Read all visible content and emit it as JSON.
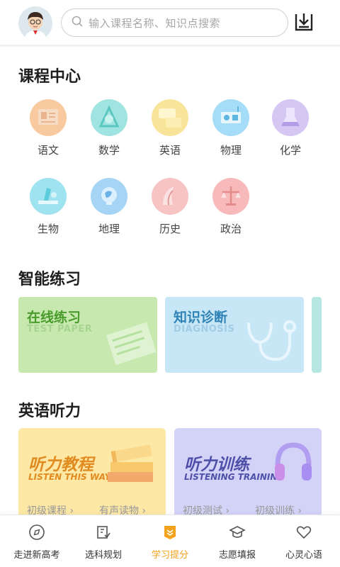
{
  "header": {
    "search_placeholder": "输入课程名称、知识点搜索"
  },
  "course_center": {
    "title": "课程中心",
    "subjects": [
      {
        "label": "语文",
        "icon": "chinese-icon",
        "color": "#f9c9a0"
      },
      {
        "label": "数学",
        "icon": "math-icon",
        "color": "#9fe4e0"
      },
      {
        "label": "英语",
        "icon": "english-icon",
        "color": "#f9e59a"
      },
      {
        "label": "物理",
        "icon": "physics-icon",
        "color": "#a5dcf7"
      },
      {
        "label": "化学",
        "icon": "chemistry-icon",
        "color": "#d5c7f3"
      },
      {
        "label": "生物",
        "icon": "biology-icon",
        "color": "#9ee3ef"
      },
      {
        "label": "地理",
        "icon": "geography-icon",
        "color": "#a5d4f4"
      },
      {
        "label": "历史",
        "icon": "history-icon",
        "color": "#f7c3c3"
      },
      {
        "label": "政治",
        "icon": "politics-icon",
        "color": "#f7b9b9"
      }
    ]
  },
  "smart_practice": {
    "title": "智能练习",
    "cards": [
      {
        "title": "在线练习",
        "subtitle": "TEST PAPER",
        "bg": "#c7e9b0",
        "color": "#4a9a2c"
      },
      {
        "title": "知识诊断",
        "subtitle": "DIAGNOSIS",
        "bg": "#c7e6f6",
        "color": "#2f84b5"
      }
    ]
  },
  "english_listening": {
    "title": "英语听力",
    "cards": [
      {
        "title": "听力教程",
        "subtitle": "LISTEN THIS WAY",
        "link1": "初级课程",
        "link2": "有声读物",
        "bg": "#fde8a6",
        "color": "#e08a1f"
      },
      {
        "title": "听力训练",
        "subtitle": "LISTENING TRAINING",
        "link1": "初级测试",
        "link2": "初级训练",
        "bg": "#d3d3f8",
        "color": "#4e4fa8"
      }
    ]
  },
  "nav": {
    "items": [
      {
        "label": "走进新高考",
        "icon": "compass-icon"
      },
      {
        "label": "选科规划",
        "icon": "plan-icon"
      },
      {
        "label": "学习提分",
        "icon": "study-icon"
      },
      {
        "label": "志愿填报",
        "icon": "graduation-cap-icon"
      },
      {
        "label": "心灵心语",
        "icon": "heart-icon"
      }
    ],
    "active_color": "#f3a21b"
  }
}
